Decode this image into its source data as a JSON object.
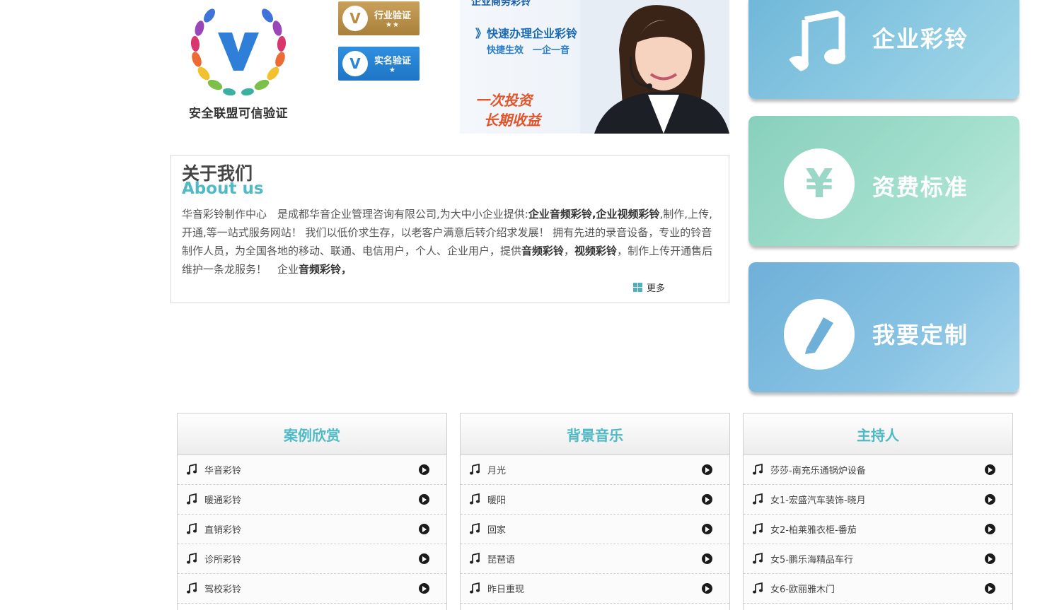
{
  "badges": {
    "main_caption": "安全联盟可信验证",
    "main_mark": "V",
    "industry": {
      "label": "行业验证",
      "stars": "★★"
    },
    "realname": {
      "label": "实名验证",
      "stars": "★"
    }
  },
  "banner": {
    "logo_text": "企业商务彩铃",
    "headline": "》快速办理企业彩铃",
    "subline": "快捷生效　一企一音",
    "slogan_line1": "一次投资",
    "slogan_line2": "长期收益"
  },
  "tiles": [
    {
      "label": "企业彩铃",
      "icon": "music-note-icon"
    },
    {
      "label": "资费标准",
      "icon": "yen-icon",
      "icon_glyph": "¥"
    },
    {
      "label": "我要定制",
      "icon": "pencil-icon"
    }
  ],
  "about": {
    "title_cn": "关于我们",
    "title_en": "About us",
    "p1": "华音彩铃制作中心　是成都华音企业管理咨询有限公司,为大中小企业提供:",
    "b1": "企业音频彩铃,企业视频彩铃",
    "p2": ",制作,上传,开通,等一站式服务网站！ 我们以低价求生存，以老客户满意后转介绍求发展！ 拥有先进的录音设备，专业的铃音制作人员，为全国各地的移动、联通、电信用户，个人、企业用户，提供",
    "b2": "音频彩铃",
    "p3": "，",
    "b3": "视频彩铃",
    "p4": "，制作上传开通售后维护一条龙服务！　企业",
    "b4": "音频彩铃，",
    "more": "更多"
  },
  "lists": [
    {
      "title": "案例欣赏",
      "items": [
        "华音彩铃",
        "暖通彩铃",
        "直销彩铃",
        "诊所彩铃",
        "驾校彩铃"
      ]
    },
    {
      "title": "背景音乐",
      "items": [
        "月光",
        "暖阳",
        "回家",
        "琵琶语",
        "昨日重现"
      ]
    },
    {
      "title": "主持人",
      "items": [
        "莎莎-南充乐通锅炉设备",
        "女1-宏盛汽车装饰-晓月",
        "女2-柏莱雅衣柜-番茄",
        "女5-鹏乐海精品车行",
        "女6-欧丽雅木门"
      ]
    }
  ]
}
